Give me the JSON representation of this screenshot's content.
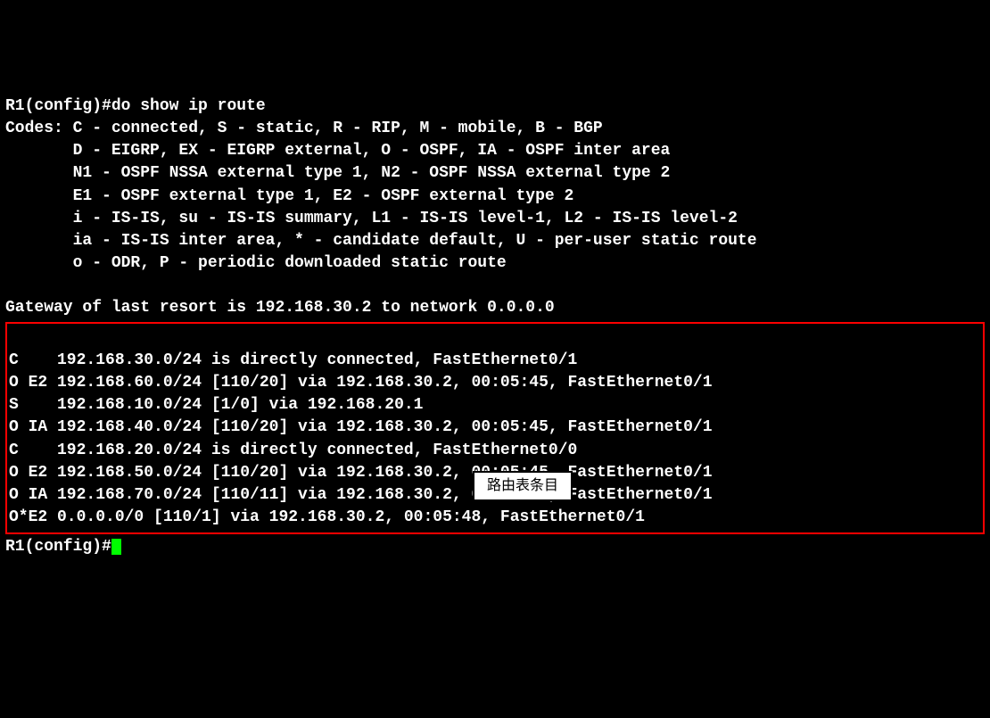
{
  "terminal": {
    "prompt1": "R1(config)#",
    "command": "do show ip route",
    "codes_header": "Codes: C - connected, S - static, R - RIP, M - mobile, B - BGP",
    "codes_line2": "       D - EIGRP, EX - EIGRP external, O - OSPF, IA - OSPF inter area",
    "codes_line3": "       N1 - OSPF NSSA external type 1, N2 - OSPF NSSA external type 2",
    "codes_line4": "       E1 - OSPF external type 1, E2 - OSPF external type 2",
    "codes_line5": "       i - IS-IS, su - IS-IS summary, L1 - IS-IS level-1, L2 - IS-IS level-2",
    "codes_line6": "       ia - IS-IS inter area, * - candidate default, U - per-user static route",
    "codes_line7": "       o - ODR, P - periodic downloaded static route",
    "gateway": "Gateway of last resort is 192.168.30.2 to network 0.0.0.0",
    "route1": "C    192.168.30.0/24 is directly connected, FastEthernet0/1",
    "route2": "O E2 192.168.60.0/24 [110/20] via 192.168.30.2, 00:05:45, FastEthernet0/1",
    "route3": "S    192.168.10.0/24 [1/0] via 192.168.20.1",
    "route4": "O IA 192.168.40.0/24 [110/20] via 192.168.30.2, 00:05:45, FastEthernet0/1",
    "route5": "C    192.168.20.0/24 is directly connected, FastEthernet0/0",
    "route6": "O E2 192.168.50.0/24 [110/20] via 192.168.30.2, 00:05:45, FastEthernet0/1",
    "route7": "O IA 192.168.70.0/24 [110/11] via 192.168.30.2, 00:05:45, FastEthernet0/1",
    "route8": "O*E2 0.0.0.0/0 [110/1] via 192.168.30.2, 00:05:48, FastEthernet0/1",
    "prompt2": "R1(config)#"
  },
  "label": {
    "text": "路由表条目"
  }
}
